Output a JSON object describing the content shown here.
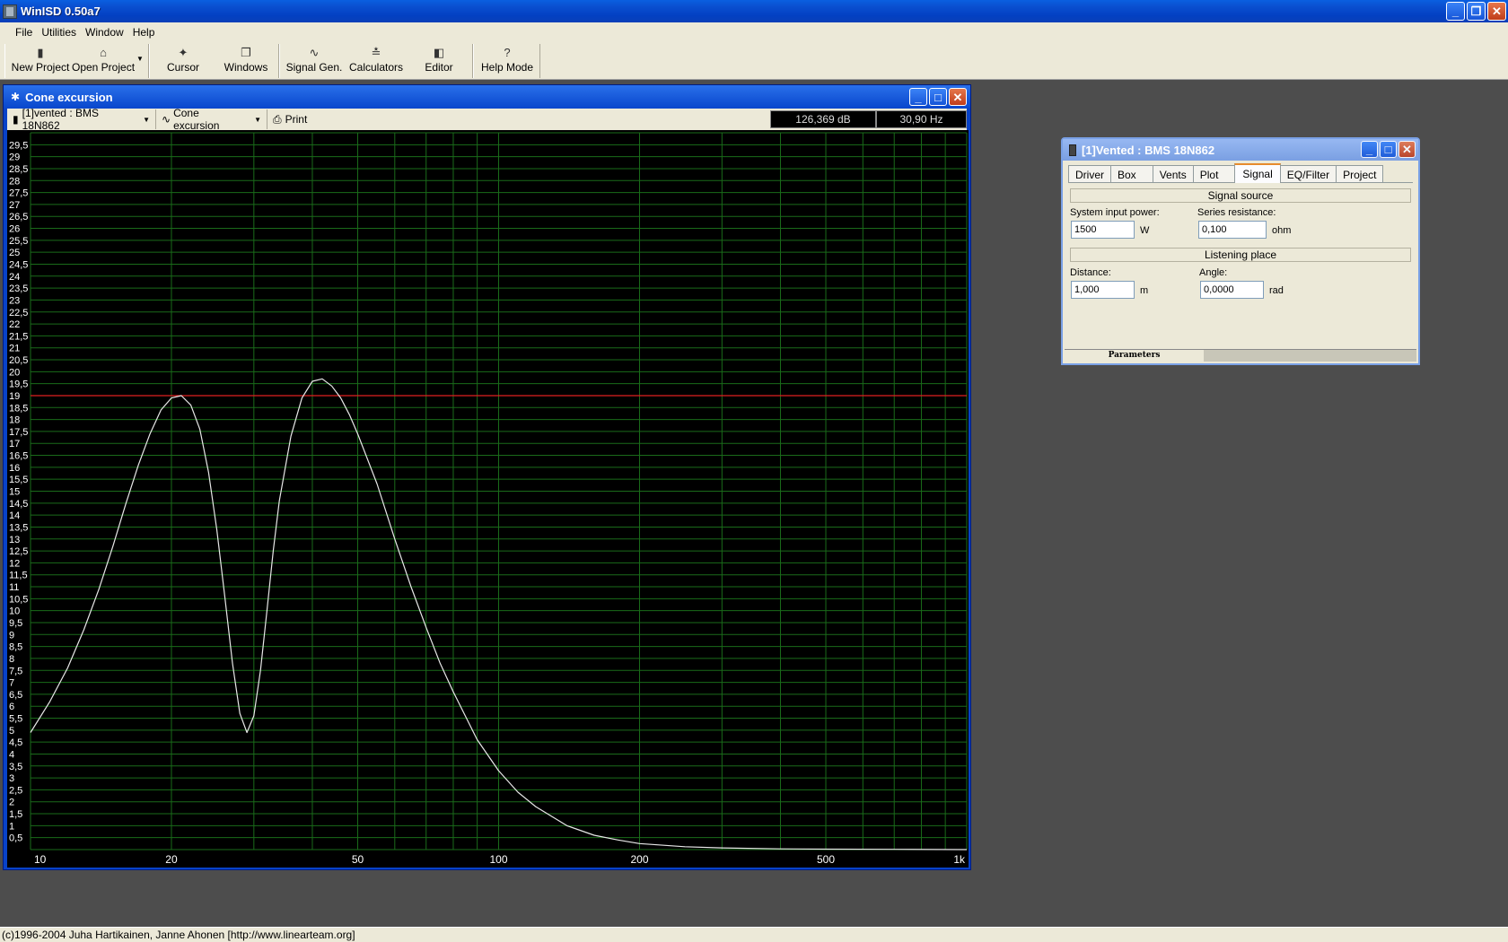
{
  "app": {
    "title": "WinISD 0.50a7",
    "caption_buttons": {
      "minimize": "_",
      "restore": "❐",
      "close": "✕"
    }
  },
  "menu": [
    "File",
    "Utilities",
    "Window",
    "Help"
  ],
  "toolbar": [
    {
      "label": "New Project",
      "icon": "new-project-icon"
    },
    {
      "label": "Open Project",
      "icon": "open-folder-icon"
    },
    {
      "label": "Cursor",
      "icon": "cursor-icon"
    },
    {
      "label": "Windows",
      "icon": "windows-icon"
    },
    {
      "label": "Signal Gen.",
      "icon": "signal-generator-icon"
    },
    {
      "label": "Calculators",
      "icon": "calculator-icon"
    },
    {
      "label": "Editor",
      "icon": "editor-icon"
    },
    {
      "label": "Help Mode",
      "icon": "help-icon"
    }
  ],
  "graph_window": {
    "title": "Cone excursion",
    "project_select": "[1]vented : BMS 18N862",
    "graph_select": "Cone excursion",
    "print_label": "Print",
    "readout_db": "126,369 dB",
    "readout_hz": "30,90 Hz"
  },
  "chart_data": {
    "type": "line",
    "title": "",
    "xlabel": "",
    "ylabel": "",
    "x_scale": "log",
    "xlim": [
      10,
      1000
    ],
    "ylim": [
      0,
      30
    ],
    "grid": true,
    "x_tick_labels": [
      {
        "value": 10,
        "label": "10"
      },
      {
        "value": 20,
        "label": "20"
      },
      {
        "value": 50,
        "label": "50"
      },
      {
        "value": 100,
        "label": "100"
      },
      {
        "value": 200,
        "label": "200"
      },
      {
        "value": 500,
        "label": "500"
      },
      {
        "value": 1000,
        "label": "1k"
      }
    ],
    "y_tick_labels": [
      "29,5",
      "29",
      "28,5",
      "28",
      "27,5",
      "27",
      "26,5",
      "26",
      "25,5",
      "25",
      "24,5",
      "24",
      "23,5",
      "23",
      "22,5",
      "22",
      "21,5",
      "21",
      "20,5",
      "20",
      "19,5",
      "19",
      "18,5",
      "18",
      "17,5",
      "17",
      "16,5",
      "16",
      "15,5",
      "15",
      "14,5",
      "14",
      "13,5",
      "13",
      "12,5",
      "12",
      "11,5",
      "11",
      "10,5",
      "10",
      "9,5",
      "9",
      "8,5",
      "8",
      "7,5",
      "7",
      "6,5",
      "6",
      "5,5",
      "5",
      "4,5",
      "4",
      "3,5",
      "3",
      "2,5",
      "2",
      "1,5",
      "1",
      "0,5"
    ],
    "reference_line": {
      "y": 19,
      "color": "#e02020"
    },
    "series": [
      {
        "color": "#e8e8e8",
        "x": [
          10,
          11,
          12,
          13,
          14,
          15,
          16,
          17,
          18,
          19,
          20,
          21,
          22,
          23,
          24,
          25,
          26,
          27,
          28,
          29,
          30,
          31,
          32,
          33,
          34,
          36,
          38,
          40,
          42,
          44,
          46,
          48,
          50,
          55,
          60,
          65,
          70,
          75,
          80,
          90,
          100,
          110,
          120,
          140,
          160,
          180,
          200,
          250,
          300,
          400,
          500,
          700,
          1000
        ],
        "y": [
          4.9,
          6.2,
          7.6,
          9.2,
          10.9,
          12.7,
          14.5,
          16.1,
          17.4,
          18.4,
          18.9,
          19.0,
          18.6,
          17.6,
          15.8,
          13.4,
          10.6,
          7.8,
          5.7,
          4.9,
          5.6,
          7.5,
          10.0,
          12.5,
          14.6,
          17.3,
          18.9,
          19.6,
          19.7,
          19.4,
          18.9,
          18.2,
          17.4,
          15.3,
          13.0,
          11.0,
          9.3,
          7.8,
          6.6,
          4.6,
          3.3,
          2.4,
          1.8,
          1.0,
          0.6,
          0.4,
          0.25,
          0.12,
          0.07,
          0.03,
          0.02,
          0.01,
          0.0
        ]
      }
    ]
  },
  "param_window": {
    "title": "[1]Vented : BMS 18N862",
    "tabs": [
      "Driver",
      "Box",
      "Vents",
      "Plot",
      "Signal",
      "EQ/Filter",
      "Project"
    ],
    "active_tab": "Signal",
    "signal_source_header": "Signal source",
    "system_input_power_label": "System input power:",
    "system_input_power_value": "1500",
    "system_input_power_unit": "W",
    "series_resistance_label": "Series resistance:",
    "series_resistance_value": "0,100",
    "series_resistance_unit": "ohm",
    "listening_place_header": "Listening place",
    "distance_label": "Distance:",
    "distance_value": "1,000",
    "distance_unit": "m",
    "angle_label": "Angle:",
    "angle_value": "0,0000",
    "angle_unit": "rad",
    "bottom_tab": "Parameters"
  },
  "status": {
    "text": "(c)1996-2004 Juha Hartikainen, Janne Ahonen [http://www.linearteam.org]"
  },
  "colors": {
    "plot_background": "#000000",
    "grid": "#1a6b1a",
    "curve": "#e8e8e8",
    "reference": "#e02020",
    "workspace": "#4d4d4d"
  }
}
